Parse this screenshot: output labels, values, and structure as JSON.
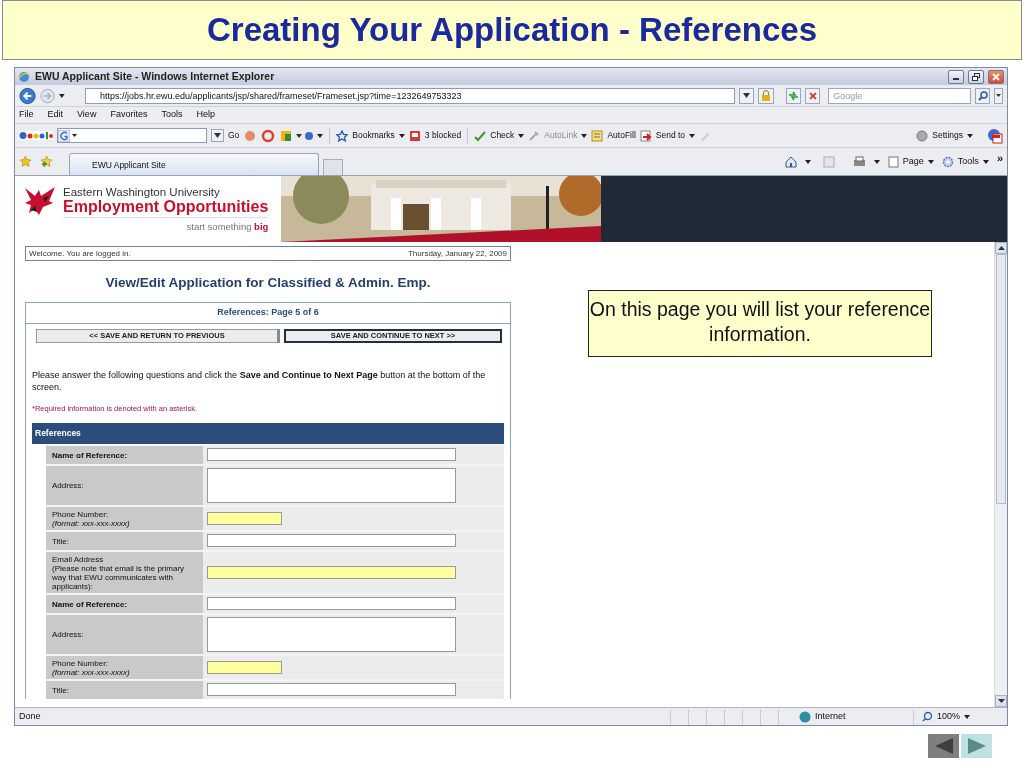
{
  "slide_title": "Creating Your Application - References",
  "browser": {
    "title": "EWU Applicant Site - Windows Internet Explorer",
    "url": "https://jobs.hr.ewu.edu/applicants/jsp/shared/frameset/Frameset.jsp?time=1232649753323",
    "search_placeholder": "Google",
    "menu": [
      "File",
      "Edit",
      "View",
      "Favorites",
      "Tools",
      "Help"
    ],
    "google_toolbar": {
      "go": "Go",
      "settings": "Settings",
      "items": [
        {
          "label": "Bookmarks",
          "dropdown": true,
          "disabled": false
        },
        {
          "label": "3 blocked",
          "dropdown": false,
          "disabled": false
        },
        {
          "label": "Check",
          "dropdown": true,
          "disabled": false
        },
        {
          "label": "AutoLink",
          "dropdown": true,
          "disabled": true
        },
        {
          "label": "AutoFill",
          "dropdown": false,
          "disabled": false
        },
        {
          "label": "Send to",
          "dropdown": true,
          "disabled": false
        }
      ]
    },
    "tabs": [
      {
        "label": "EWU Applicant Site",
        "selected": true
      }
    ],
    "command_bar": {
      "page": "Page",
      "tools": "Tools",
      "overflow": "»"
    },
    "status": "Done",
    "zone": "Internet",
    "zoom": "100%"
  },
  "page": {
    "university": "Eastern Washington University",
    "site_name": "Employment Opportunities",
    "tagline": "start something **big**",
    "welcome": "Welcome. You are logged in.",
    "date": "Thursday, January 22, 2009",
    "heading": "View/Edit Application for Classified & Admin. Emp.",
    "section": "References: Page 5 of 6",
    "buttons": [
      "<< SAVE AND RETURN TO PREVIOUS",
      "SAVE AND CONTINUE TO NEXT >>"
    ],
    "instructions": "Please answer the following questions and click the **Save and Continue to Next Page** button at the bottom of the screen.",
    "required_note": "*Required information is denoted with an asterisk.",
    "panel_title": "References",
    "fields": [
      {
        "label": "Name of Reference:",
        "bold": true,
        "kind": "text",
        "highlighted": false
      },
      {
        "label": "Address:",
        "bold": false,
        "kind": "textarea",
        "highlighted": false
      },
      {
        "label": "Phone Number:",
        "format": "(format: xxx-xxx-xxxx)",
        "bold": false,
        "kind": "short",
        "highlighted": true
      },
      {
        "label": "Title:",
        "bold": false,
        "kind": "text",
        "highlighted": false
      },
      {
        "label": "Email Address",
        "detail": "(Please note that email is the primary way that EWU communicates with applicants):",
        "bold": false,
        "kind": "text",
        "highlighted": true
      },
      {
        "label": "Name of Reference:",
        "bold": true,
        "kind": "text",
        "highlighted": false
      },
      {
        "label": "Address:",
        "bold": false,
        "kind": "textarea",
        "highlighted": false
      },
      {
        "label": "Phone Number:",
        "format": "(format: xxx-xxx-xxxx)",
        "bold": false,
        "kind": "short",
        "highlighted": true
      },
      {
        "label": "Title:",
        "bold": false,
        "kind": "text",
        "highlighted": false
      }
    ]
  },
  "callout": "On this page you will list your reference information."
}
